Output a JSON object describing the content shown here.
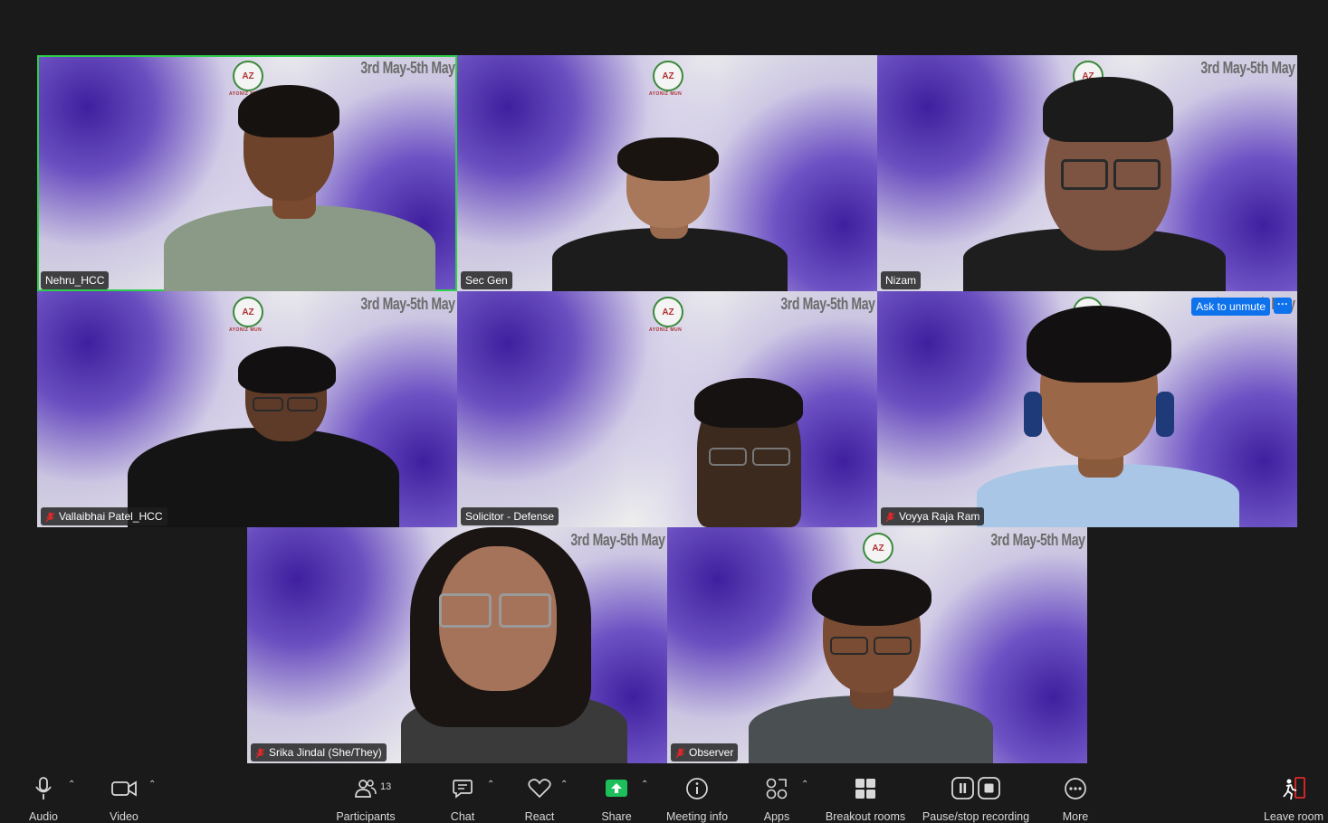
{
  "banner_text": "3rd May-5th May",
  "logo_text": "AZ",
  "logo_subtext": "AYONIZ MUN",
  "tiles": [
    {
      "name": "Nehru_HCC",
      "muted": false,
      "active": true
    },
    {
      "name": "Sec Gen",
      "muted": false,
      "active": false
    },
    {
      "name": "Nizam",
      "muted": false,
      "active": false
    },
    {
      "name": "Vallaibhai Patel_HCC",
      "muted": true,
      "active": false
    },
    {
      "name": "Solicitor - Defense",
      "muted": false,
      "active": false
    },
    {
      "name": "Voyya Raja Ram",
      "muted": true,
      "active": false
    },
    {
      "name": "Srika Jindal (She/They)",
      "muted": true,
      "active": false
    },
    {
      "name": "Observer",
      "muted": true,
      "active": false
    }
  ],
  "ask_to_unmute_label": "Ask to unmute",
  "tile_more_label": "···",
  "toolbar": {
    "audio": "Audio",
    "video": "Video",
    "participants": "Participants",
    "participants_count": "13",
    "chat": "Chat",
    "react": "React",
    "share": "Share",
    "meeting_info": "Meeting info",
    "apps": "Apps",
    "breakout_rooms": "Breakout rooms",
    "pause_stop_recording": "Pause/stop recording",
    "more": "More",
    "leave_room": "Leave room"
  },
  "colors": {
    "active_speaker_border": "#2fcf4e",
    "share_green": "#1dbf5a",
    "unmute_blue": "#0e72ed",
    "muted_red": "#e02828",
    "leave_red": "#e02828"
  }
}
